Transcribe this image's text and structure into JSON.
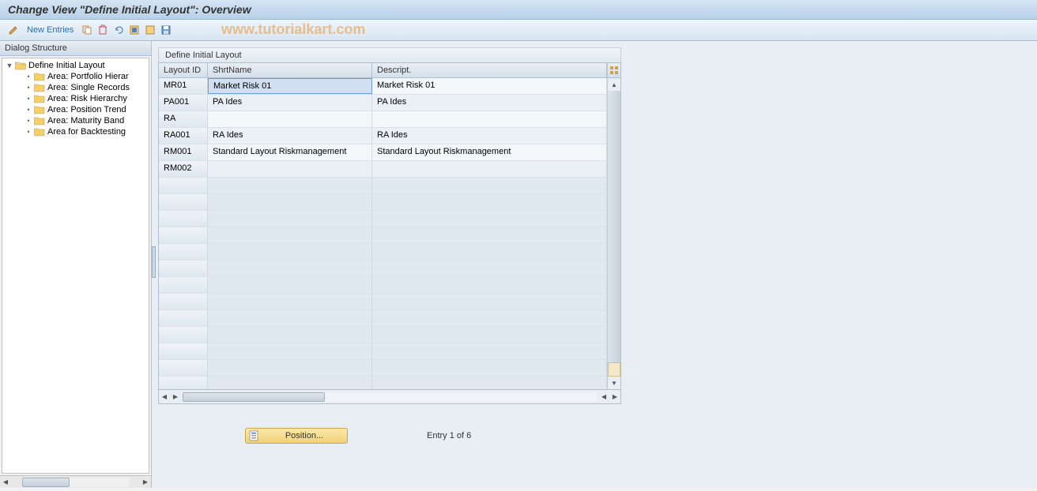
{
  "title": "Change View \"Define Initial Layout\": Overview",
  "toolbar": {
    "new_entries": "New Entries"
  },
  "watermark": "www.tutorialkart.com",
  "sidebar": {
    "header": "Dialog Structure",
    "root": "Define Initial Layout",
    "children": [
      "Area: Portfolio Hierar",
      "Area: Single Records",
      "Area: Risk Hierarchy",
      "Area: Position Trend",
      "Area: Maturity Band",
      "Area for Backtesting"
    ]
  },
  "panel": {
    "title": "Define Initial Layout",
    "columns": {
      "layout_id": "Layout ID",
      "short_name": "ShrtName",
      "descript": "Descript."
    },
    "rows": [
      {
        "id": "MR01",
        "short": "Market Risk 01",
        "desc": "Market Risk 01"
      },
      {
        "id": "PA001",
        "short": "PA Ides",
        "desc": "PA Ides"
      },
      {
        "id": "RA",
        "short": "",
        "desc": ""
      },
      {
        "id": "RA001",
        "short": "RA Ides",
        "desc": "RA Ides"
      },
      {
        "id": "RM001",
        "short": "Standard Layout Riskmanagement",
        "desc": "Standard Layout Riskmanagement"
      },
      {
        "id": "RM002",
        "short": "",
        "desc": ""
      }
    ]
  },
  "footer": {
    "position_label": "Position...",
    "entry_text": "Entry 1 of 6"
  }
}
